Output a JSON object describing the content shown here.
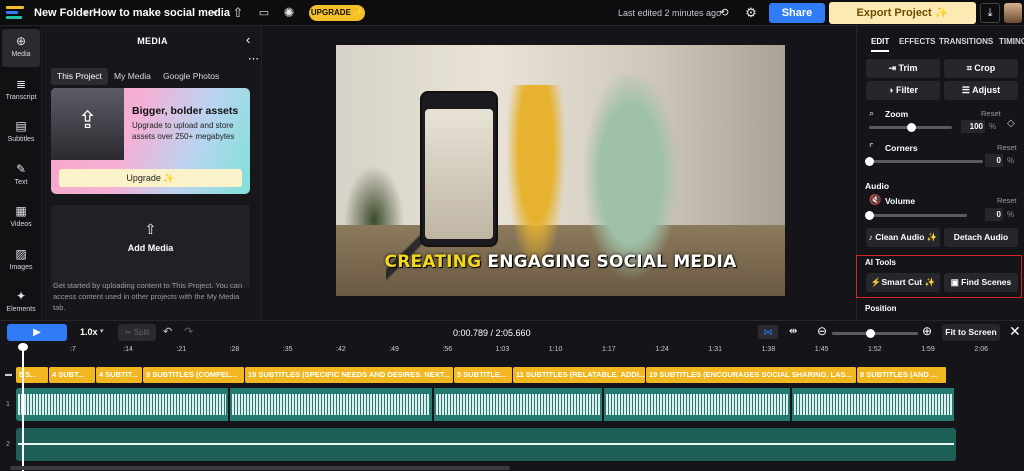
{
  "header": {
    "folder": "New Folder",
    "separator": "›",
    "project_title": "How to make social media",
    "upgrade_label": "UPGRADE ✨",
    "last_edited": "Last edited 2 minutes ago",
    "share_label": "Share",
    "export_label": "Export Project ✨"
  },
  "rail": {
    "items": [
      {
        "label": "Media",
        "icon": "media-icon"
      },
      {
        "label": "Transcript",
        "icon": "transcript-icon"
      },
      {
        "label": "Subtitles",
        "icon": "subtitles-icon"
      },
      {
        "label": "Text",
        "icon": "text-icon"
      },
      {
        "label": "Videos",
        "icon": "videos-icon"
      },
      {
        "label": "Images",
        "icon": "images-icon"
      },
      {
        "label": "Elements",
        "icon": "elements-icon"
      }
    ]
  },
  "media": {
    "title": "MEDIA",
    "tabs": [
      "This Project",
      "My Media",
      "Google Photos"
    ],
    "promo_title": "Bigger, bolder assets",
    "promo_text": "Upgrade to upload and store assets over 250+ megabytes",
    "promo_button": "Upgrade ✨",
    "add_media": "Add Media",
    "help_text": "Get started by uploading content to This Project. You can access content used in other projects with the My Media tab."
  },
  "preview": {
    "subtitle_highlight": "CREATING",
    "subtitle_rest": " ENGAGING SOCIAL MEDIA"
  },
  "right": {
    "tabs": [
      "EDIT",
      "EFFECTS",
      "TRANSITIONS",
      "TIMING"
    ],
    "trim": "Trim",
    "crop": "Crop",
    "filter": "Filter",
    "adjust": "Adjust",
    "zoom_label": "Zoom",
    "zoom_value": "100",
    "corners_label": "Corners",
    "corners_value": "0",
    "audio_heading": "Audio",
    "volume_label": "Volume",
    "volume_value": "0",
    "reset": "Reset",
    "unit": "%",
    "clean_audio": "Clean Audio ✨",
    "detach_audio": "Detach Audio",
    "ai_heading": "AI Tools",
    "smart_cut": "Smart Cut ✨",
    "find_scenes": "Find Scenes",
    "position_heading": "Position",
    "zoom_fraction": 0.5,
    "corners_fraction": 0,
    "volume_fraction": 0
  },
  "timeline": {
    "speed": "1.0x",
    "split": "Split",
    "timecode": "0:00.789 / 2:05.660",
    "fit": "Fit to Screen",
    "ticks": [
      ":7",
      ":14",
      ":21",
      ":28",
      ":35",
      ":42",
      ":49",
      ":56",
      "1:03",
      "1:10",
      "1:17",
      "1:24",
      "1:31",
      "1:38",
      "1:45",
      "1:52",
      "1:59",
      "2:06"
    ],
    "subtitle_segments": [
      {
        "label": "5 S..."
      },
      {
        "label": "4 SUBT..."
      },
      {
        "label": "4 SUBTIT..."
      },
      {
        "label": "9 SUBTITLES (COMPEL..."
      },
      {
        "label": "19 SUBTITLES (SPECIFIC NEEDS AND DESIRES. NEXT..."
      },
      {
        "label": "5 SUBTITLE..."
      },
      {
        "label": "11 SUBTITLES (RELATABLE. ADDI..."
      },
      {
        "label": "19 SUBTITLES (ENCOURAGES SOCIAL SHARING. LAS..."
      },
      {
        "label": "8 SUBTITLES (AND ..."
      }
    ],
    "track_numbers": [
      "1",
      "2"
    ]
  }
}
